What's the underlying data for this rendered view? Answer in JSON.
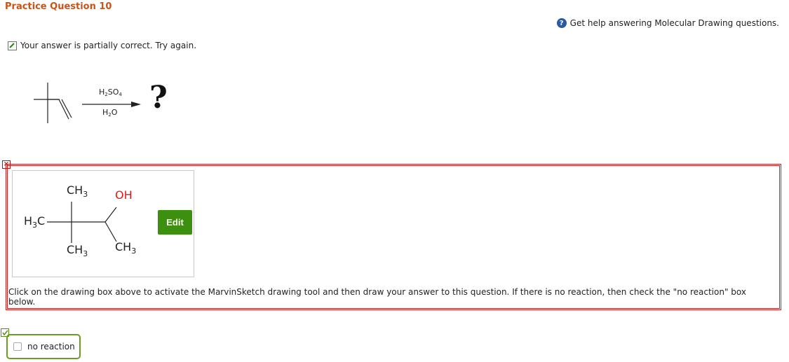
{
  "header": {
    "title": "Practice Question 10"
  },
  "help": {
    "icon": "question-circle-icon",
    "label": "Get help answering Molecular Drawing questions."
  },
  "status": {
    "icon": "pencil-square-icon",
    "text": "Your answer is partially correct.  Try again."
  },
  "reaction": {
    "reagent_top": {
      "main": "H",
      "sub": "2",
      "rest": "SO",
      "sub2": "4"
    },
    "reagent_bottom": {
      "main": "H",
      "sub": "2",
      "rest": "O"
    },
    "product": "?"
  },
  "answer": {
    "incorrect_icon": "x-mark-icon",
    "labels": {
      "ch3_top": "CH",
      "ch3_top_sub": "3",
      "h3c": "H",
      "h3c_sub": "3",
      "h3c_rest": "C",
      "ch3_bottom": "CH",
      "ch3_bottom_sub": "3",
      "oh": "OH",
      "ch3_right": "CH",
      "ch3_right_sub": "3"
    },
    "edit_label": "Edit",
    "instructions": "Click on the drawing box above to activate the MarvinSketch drawing tool and then draw your answer to this question. If there is no reaction, then check the \"no reaction\" box below."
  },
  "no_reaction": {
    "label": "no reaction",
    "status_icon": "check-mark-icon"
  },
  "colors": {
    "accent": "#c9541a",
    "error": "#d21f1f",
    "success": "#3c8f0f",
    "oh": "#e01b1b"
  }
}
